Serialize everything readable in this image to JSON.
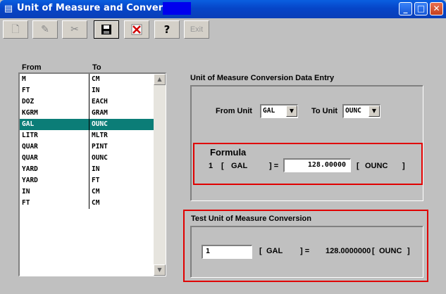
{
  "window": {
    "title": "Unit of Measure and Conversion",
    "title_icon": "form-icon",
    "buttons": {
      "minimize": "_",
      "maximize": "□",
      "close": "✕"
    }
  },
  "toolbar": {
    "new_icon": "🗋",
    "edit_icon": "✎",
    "cut_icon": "✂",
    "save_icon": "💾",
    "delete_icon": "✖",
    "help_icon": "?",
    "exit_label": "Exit"
  },
  "list": {
    "header_from": "From",
    "header_to": "To",
    "rows": [
      {
        "from": "M",
        "to": "CM"
      },
      {
        "from": "FT",
        "to": "IN"
      },
      {
        "from": "DOZ",
        "to": "EACH"
      },
      {
        "from": "KGRM",
        "to": "GRAM"
      },
      {
        "from": "GAL",
        "to": "OUNC"
      },
      {
        "from": "LITR",
        "to": "MLTR"
      },
      {
        "from": "QUAR",
        "to": "PINT"
      },
      {
        "from": "QUAR",
        "to": "OUNC"
      },
      {
        "from": "YARD",
        "to": "IN"
      },
      {
        "from": "YARD",
        "to": "FT"
      },
      {
        "from": "IN",
        "to": "CM"
      },
      {
        "from": "FT",
        "to": "CM"
      }
    ],
    "selected_index": 4,
    "scroll_up": "▲",
    "scroll_down": "▼"
  },
  "entry": {
    "title": "Unit of Measure Conversion Data Entry",
    "from_label": "From Unit",
    "from_value": "GAL",
    "to_label": "To Unit",
    "to_value": "OUNC",
    "dropdown_arrow": "▼",
    "formula_label": "Formula",
    "formula_qty": "1",
    "formula_open1": "[",
    "formula_from_unit": "GAL",
    "formula_close_eq": "] =",
    "formula_value": "128.00000",
    "formula_open2": "[",
    "formula_to_unit": "OUNC",
    "formula_close2": "]"
  },
  "test": {
    "title": "Test Unit of Measure Conversion",
    "input_value": "1",
    "open1": "[",
    "from_unit": "GAL",
    "close_eq": "] =",
    "result": "128.0000000",
    "open2": "[",
    "to_unit": "OUNC",
    "close2": "]"
  },
  "colors": {
    "title_bar": "#0645c8",
    "selection": "#0b7d77",
    "highlight_box": "#e00000",
    "face": "#c0c0c0"
  }
}
